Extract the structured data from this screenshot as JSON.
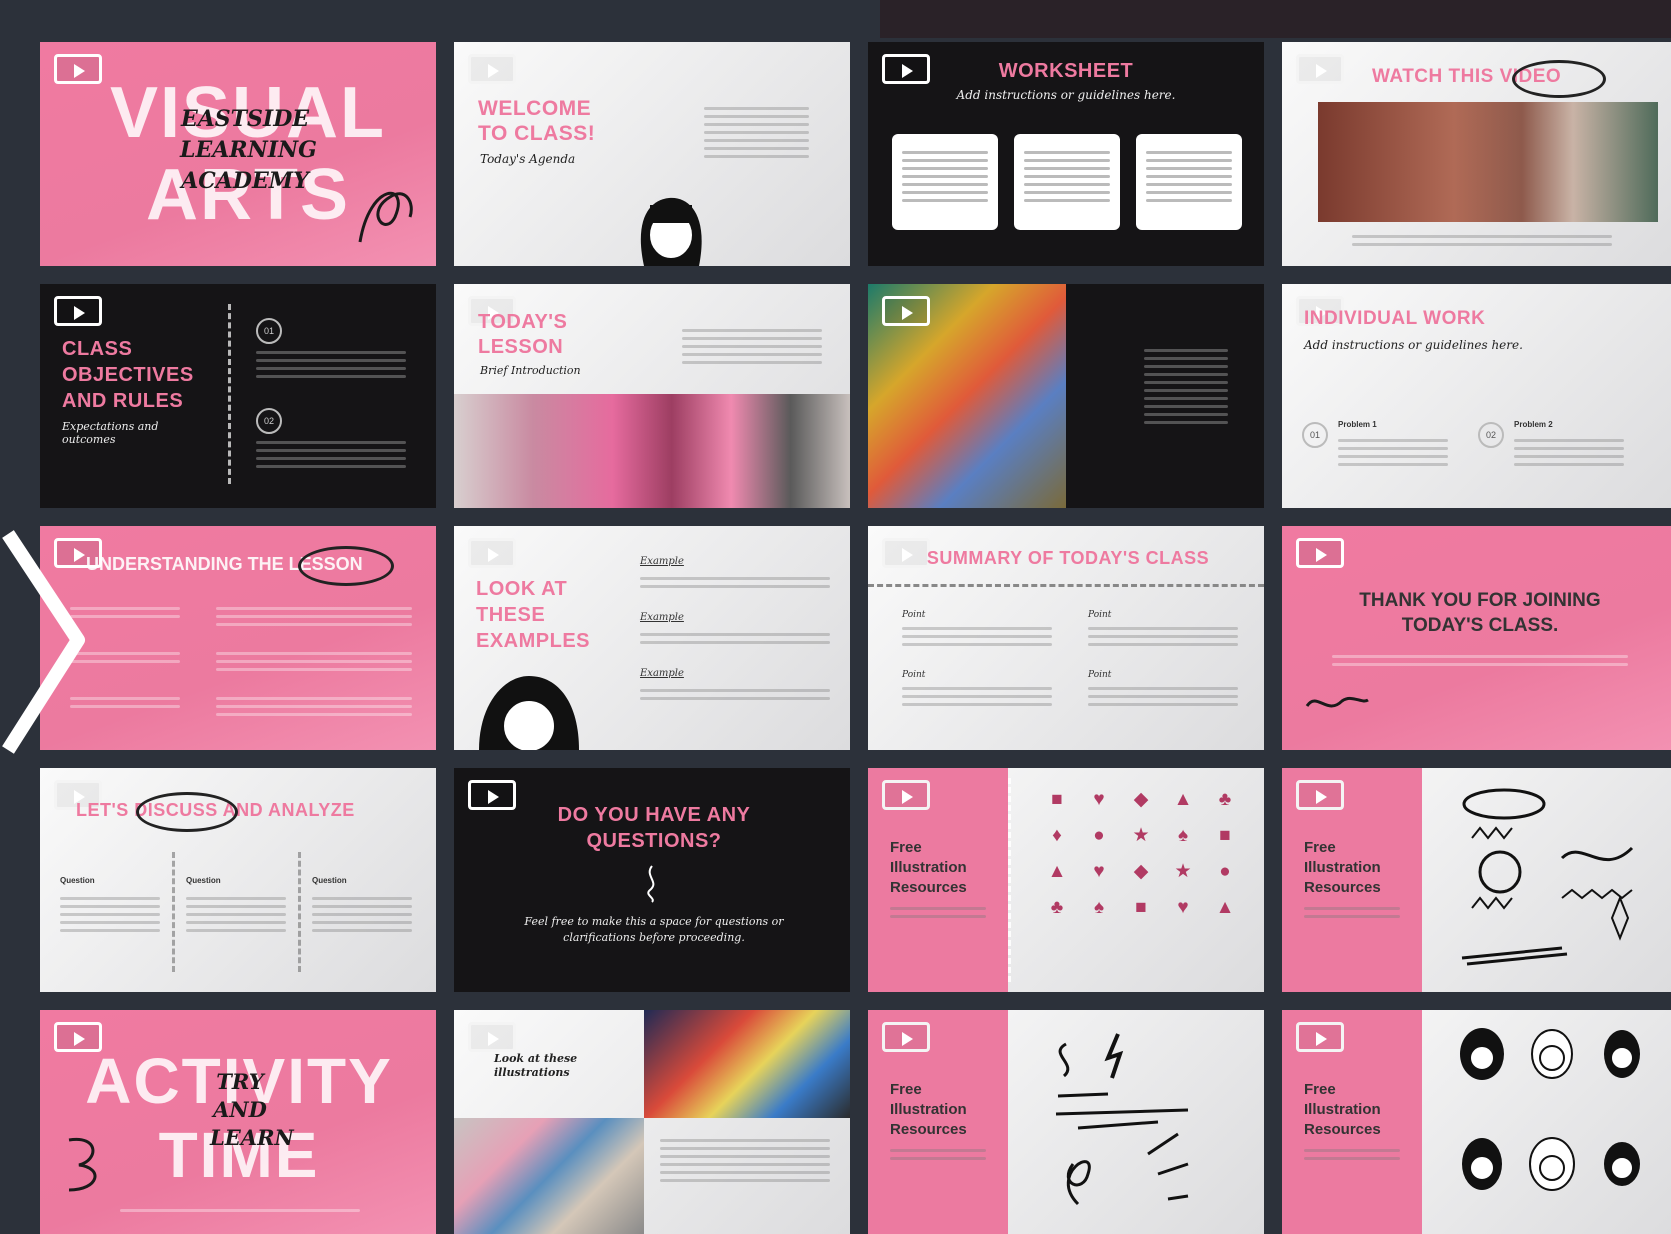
{
  "slides": [
    {
      "title_big": "VISUAL ARTS",
      "subtitle": "EASTSIDE LEARNING ACADEMY"
    },
    {
      "title": "WELCOME TO CLASS!",
      "subtitle": "Today's Agenda"
    },
    {
      "title": "WORKSHEET",
      "subtitle": "Add instructions or guidelines here."
    },
    {
      "title": "WATCH THIS VIDEO"
    },
    {
      "title": "CLASS OBJECTIVES AND RULES",
      "subtitle": "Expectations and outcomes",
      "num1": "01",
      "num2": "02"
    },
    {
      "title": "TODAY'S LESSON",
      "subtitle": "Brief Introduction"
    },
    {
      "title": ""
    },
    {
      "title": "INDIVIDUAL WORK",
      "subtitle": "Add instructions or guidelines here.",
      "label1": "Problem 1",
      "label2": "Problem 2",
      "num1": "01",
      "num2": "02"
    },
    {
      "title": "UNDERSTANDING THE LESSON"
    },
    {
      "title": "LOOK AT THESE EXAMPLES",
      "ex": "Example"
    },
    {
      "title": "SUMMARY OF TODAY'S CLASS",
      "point": "Point"
    },
    {
      "title": "THANK YOU FOR JOINING TODAY'S CLASS."
    },
    {
      "title": "LET'S DISCUSS AND ANALYZE",
      "q": "Question"
    },
    {
      "title": "DO YOU HAVE ANY QUESTIONS?",
      "subtitle": "Feel free to make this a space for questions or clarifications before proceeding."
    },
    {
      "title": "Free Illustration Resources"
    },
    {
      "title": "Free Illustration Resources"
    },
    {
      "title_big": "ACTIVITY TIME",
      "subtitle": "TRY AND LEARN"
    },
    {
      "title": "Look at these illustrations"
    },
    {
      "title": "Free Illustration Resources"
    },
    {
      "title": "Free Illustration Resources"
    }
  ],
  "icons": {
    "grid": [
      "■",
      "♥",
      "◆",
      "▲",
      "♣",
      "♦",
      "●",
      "★",
      "♠",
      "■",
      "▲",
      "♥",
      "◆",
      "★",
      "●",
      "♣",
      "♠",
      "■",
      "♥",
      "▲"
    ]
  },
  "colors": {
    "pink": "#ee7aa0",
    "dark": "#151416",
    "panel": "#2c313a"
  }
}
